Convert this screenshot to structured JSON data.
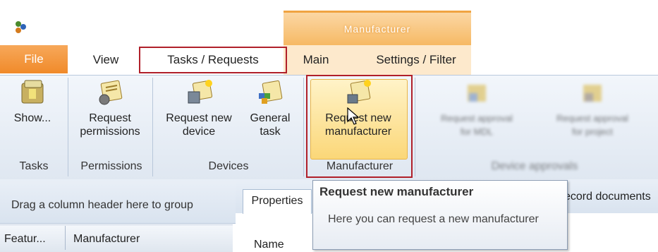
{
  "title_bar": {
    "context_group_label": "Manufacturer",
    "app_icon": "app-logo-icon"
  },
  "tabs": {
    "file": "File",
    "view": "View",
    "tasks_requests": "Tasks / Requests",
    "main": "Main",
    "settings_filter": "Settings / Filter"
  },
  "ribbon": {
    "show": {
      "label": "Show...",
      "icon": "tasks-box-icon"
    },
    "request_permissions": {
      "label": "Request\npermissions",
      "icon": "permission-request-icon"
    },
    "request_new_device": {
      "label": "Request new\ndevice",
      "icon": "device-request-icon"
    },
    "general_task": {
      "label": "General\ntask",
      "icon": "general-task-icon"
    },
    "request_new_manufacturer": {
      "label": "Request new\nmanufacturer",
      "icon": "manufacturer-request-icon"
    },
    "groups": {
      "tasks": "Tasks",
      "permissions": "Permissions",
      "devices": "Devices",
      "manufacturer": "Manufacturer",
      "device_approvals": "Device approvals"
    },
    "blurred_buttons": [
      {
        "label": "Request approval\nfor MDL",
        "icon": "approval-icon"
      },
      {
        "label": "Request approval\nfor project",
        "icon": "approval-project-icon"
      }
    ]
  },
  "grid": {
    "group_hint": "Drag a column header here to group",
    "columns": [
      "Featur...",
      "Manufacturer"
    ]
  },
  "detail": {
    "tabs": [
      "Properties",
      "ecord documents"
    ],
    "name_label": "Name"
  },
  "tooltip": {
    "title": "Request new manufacturer",
    "body": "Here you can request a new manufacturer"
  },
  "colors": {
    "file_tab": "#f08a2a",
    "context_header": "#f6b760",
    "highlight_frame": "#b0202a"
  }
}
